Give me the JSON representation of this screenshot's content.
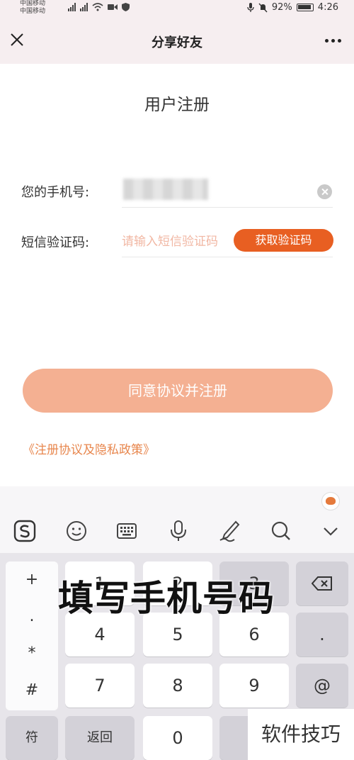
{
  "status_bar": {
    "carrier1": "中国移动",
    "carrier2": "中国移动",
    "battery": "92%",
    "time": "4:26"
  },
  "header": {
    "title": "分享好友"
  },
  "form": {
    "title": "用户注册",
    "phone_label": "您的手机号:",
    "code_label": "短信验证码:",
    "code_placeholder": "请输入短信验证码",
    "get_code_button": "获取验证码",
    "register_button": "同意协议并注册",
    "policy_link": "《注册协议及隐私政策》"
  },
  "keyboard": {
    "side_keys": [
      "+",
      ".",
      "*",
      "#"
    ],
    "row1": [
      "1",
      "2",
      "3"
    ],
    "row2": [
      "4",
      "5",
      "6"
    ],
    "row3": [
      "7",
      "8",
      "9"
    ],
    "right_keys": [
      ".",
      "@"
    ],
    "bottom": {
      "symbols": "符",
      "back": "返回",
      "zero": "0"
    }
  },
  "overlay": {
    "caption": "填写手机号码",
    "watermark": "软件技巧"
  },
  "colors": {
    "accent": "#e85f22",
    "register_button": "#f4b092",
    "policy_link": "#e8874e"
  }
}
